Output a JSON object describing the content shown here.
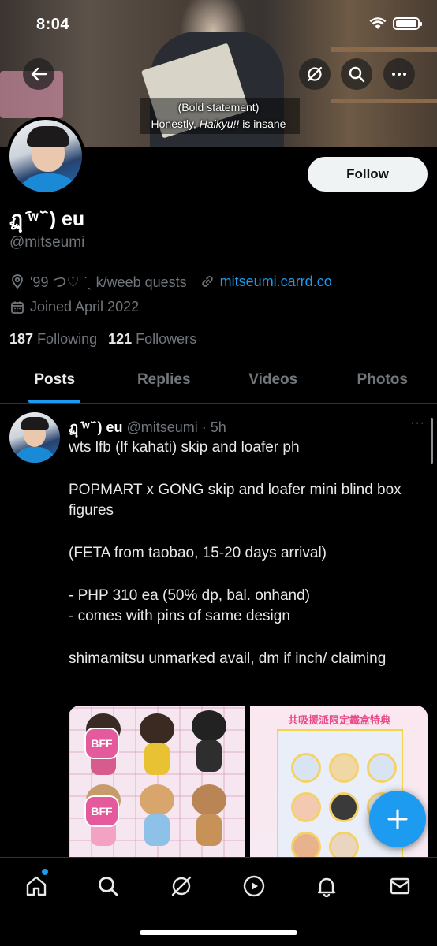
{
  "status_bar": {
    "time": "8:04"
  },
  "banner": {
    "caption_line1": "(Bold statement)",
    "caption_line2_prefix": "Honestly, ",
    "caption_line2_italic": "Haikyu!!",
    "caption_line2_suffix": " is insane"
  },
  "profile": {
    "display_name": "ฏฺ ᷇ʷ ᷈ ) eu",
    "handle": "@mitseumi",
    "location": "'99 つ♡ ͘ ˎ k/weeb quests",
    "website": "mitseumi.carrd.co",
    "joined": "Joined April 2022",
    "following_count": "187",
    "following_label": "Following",
    "followers_count": "121",
    "followers_label": "Followers",
    "follow_button": "Follow"
  },
  "tabs": [
    {
      "label": "Posts",
      "active": true
    },
    {
      "label": "Replies",
      "active": false
    },
    {
      "label": "Videos",
      "active": false
    },
    {
      "label": "Photos",
      "active": false
    }
  ],
  "post": {
    "name": "ฏฺ ᷇ʷ ᷈ ) eu",
    "handle": "@mitseumi",
    "separator": "·",
    "time": "5h",
    "more": "···",
    "paragraphs": [
      "wts lfb (lf kahati) skip and loafer ph",
      "POPMART x GONG skip and loafer mini blind box figures",
      "(FETA from taobao, 15-20 days arrival)",
      "- PHP 310 ea (50% dp, bal. onhand)\n- comes with pins of same design",
      "shimamitsu unmarked avail, dm if inch/ claiming"
    ],
    "media1_badge": "BFF",
    "media2_title": "共吸援派限定鐵盒特典"
  },
  "colors": {
    "accent": "#1d9bf0",
    "background": "#000000",
    "text_primary": "#e7e9ea",
    "text_secondary": "#71767b"
  },
  "bottom_nav": [
    "home-icon",
    "search-icon",
    "grok-icon",
    "video-icon",
    "notifications-icon",
    "messages-icon"
  ]
}
